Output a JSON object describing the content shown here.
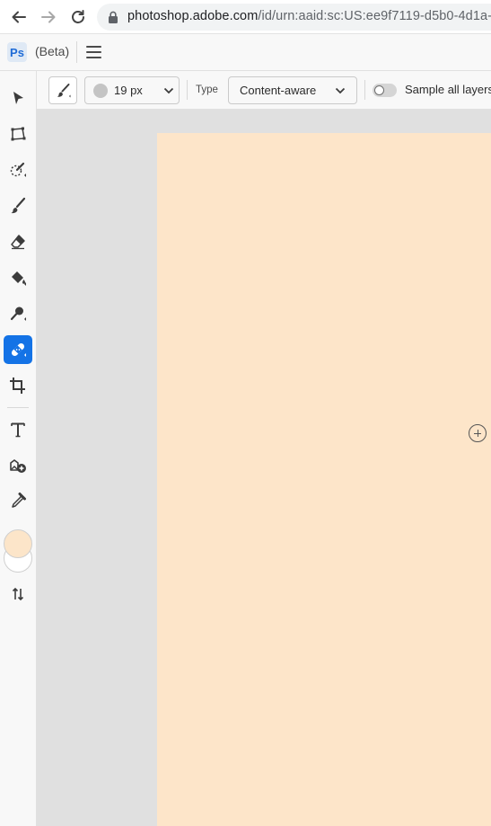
{
  "browser": {
    "url_host": "photoshop.adobe.com",
    "url_path": "/id/urn:aaid:sc:US:ee9f7119-d5b0-4d1a-"
  },
  "app": {
    "logo_text": "Ps",
    "beta_label": "(Beta)"
  },
  "toolbar": {
    "tools": [
      {
        "name": "move-tool",
        "icon": "arrow-pointer-icon",
        "active": false
      },
      {
        "name": "transform-tool",
        "icon": "transform-icon",
        "active": false
      },
      {
        "name": "quick-selection-tool",
        "icon": "quick-selection-icon",
        "active": false
      },
      {
        "name": "brush-tool",
        "icon": "brush-icon",
        "active": false
      },
      {
        "name": "eraser-tool",
        "icon": "eraser-icon",
        "active": false
      },
      {
        "name": "paint-bucket-tool",
        "icon": "paint-bucket-icon",
        "active": false
      },
      {
        "name": "dodge-tool",
        "icon": "dodge-icon",
        "active": false
      },
      {
        "name": "spot-healing-tool",
        "icon": "bandage-icon",
        "active": true
      },
      {
        "name": "crop-tool",
        "icon": "crop-icon",
        "active": false
      },
      {
        "name": "type-tool",
        "icon": "type-icon",
        "active": false
      },
      {
        "name": "add-image-tool",
        "icon": "add-image-icon",
        "active": false
      },
      {
        "name": "eyedropper-tool",
        "icon": "eyedropper-icon",
        "active": false
      },
      {
        "name": "swap-colors",
        "icon": "swap-icon",
        "active": false
      }
    ],
    "foreground_color": "#fce5c9",
    "background_color": "#ffffff"
  },
  "options": {
    "brush_size": "19 px",
    "type_label": "Type",
    "type_value": "Content-aware",
    "sample_all_layers_label": "Sample all layers",
    "sample_all_layers_on": false
  },
  "canvas": {
    "fill_color": "#fde5c9"
  },
  "colors": {
    "accent": "#1473e6",
    "workspace": "#e0e0e0"
  }
}
